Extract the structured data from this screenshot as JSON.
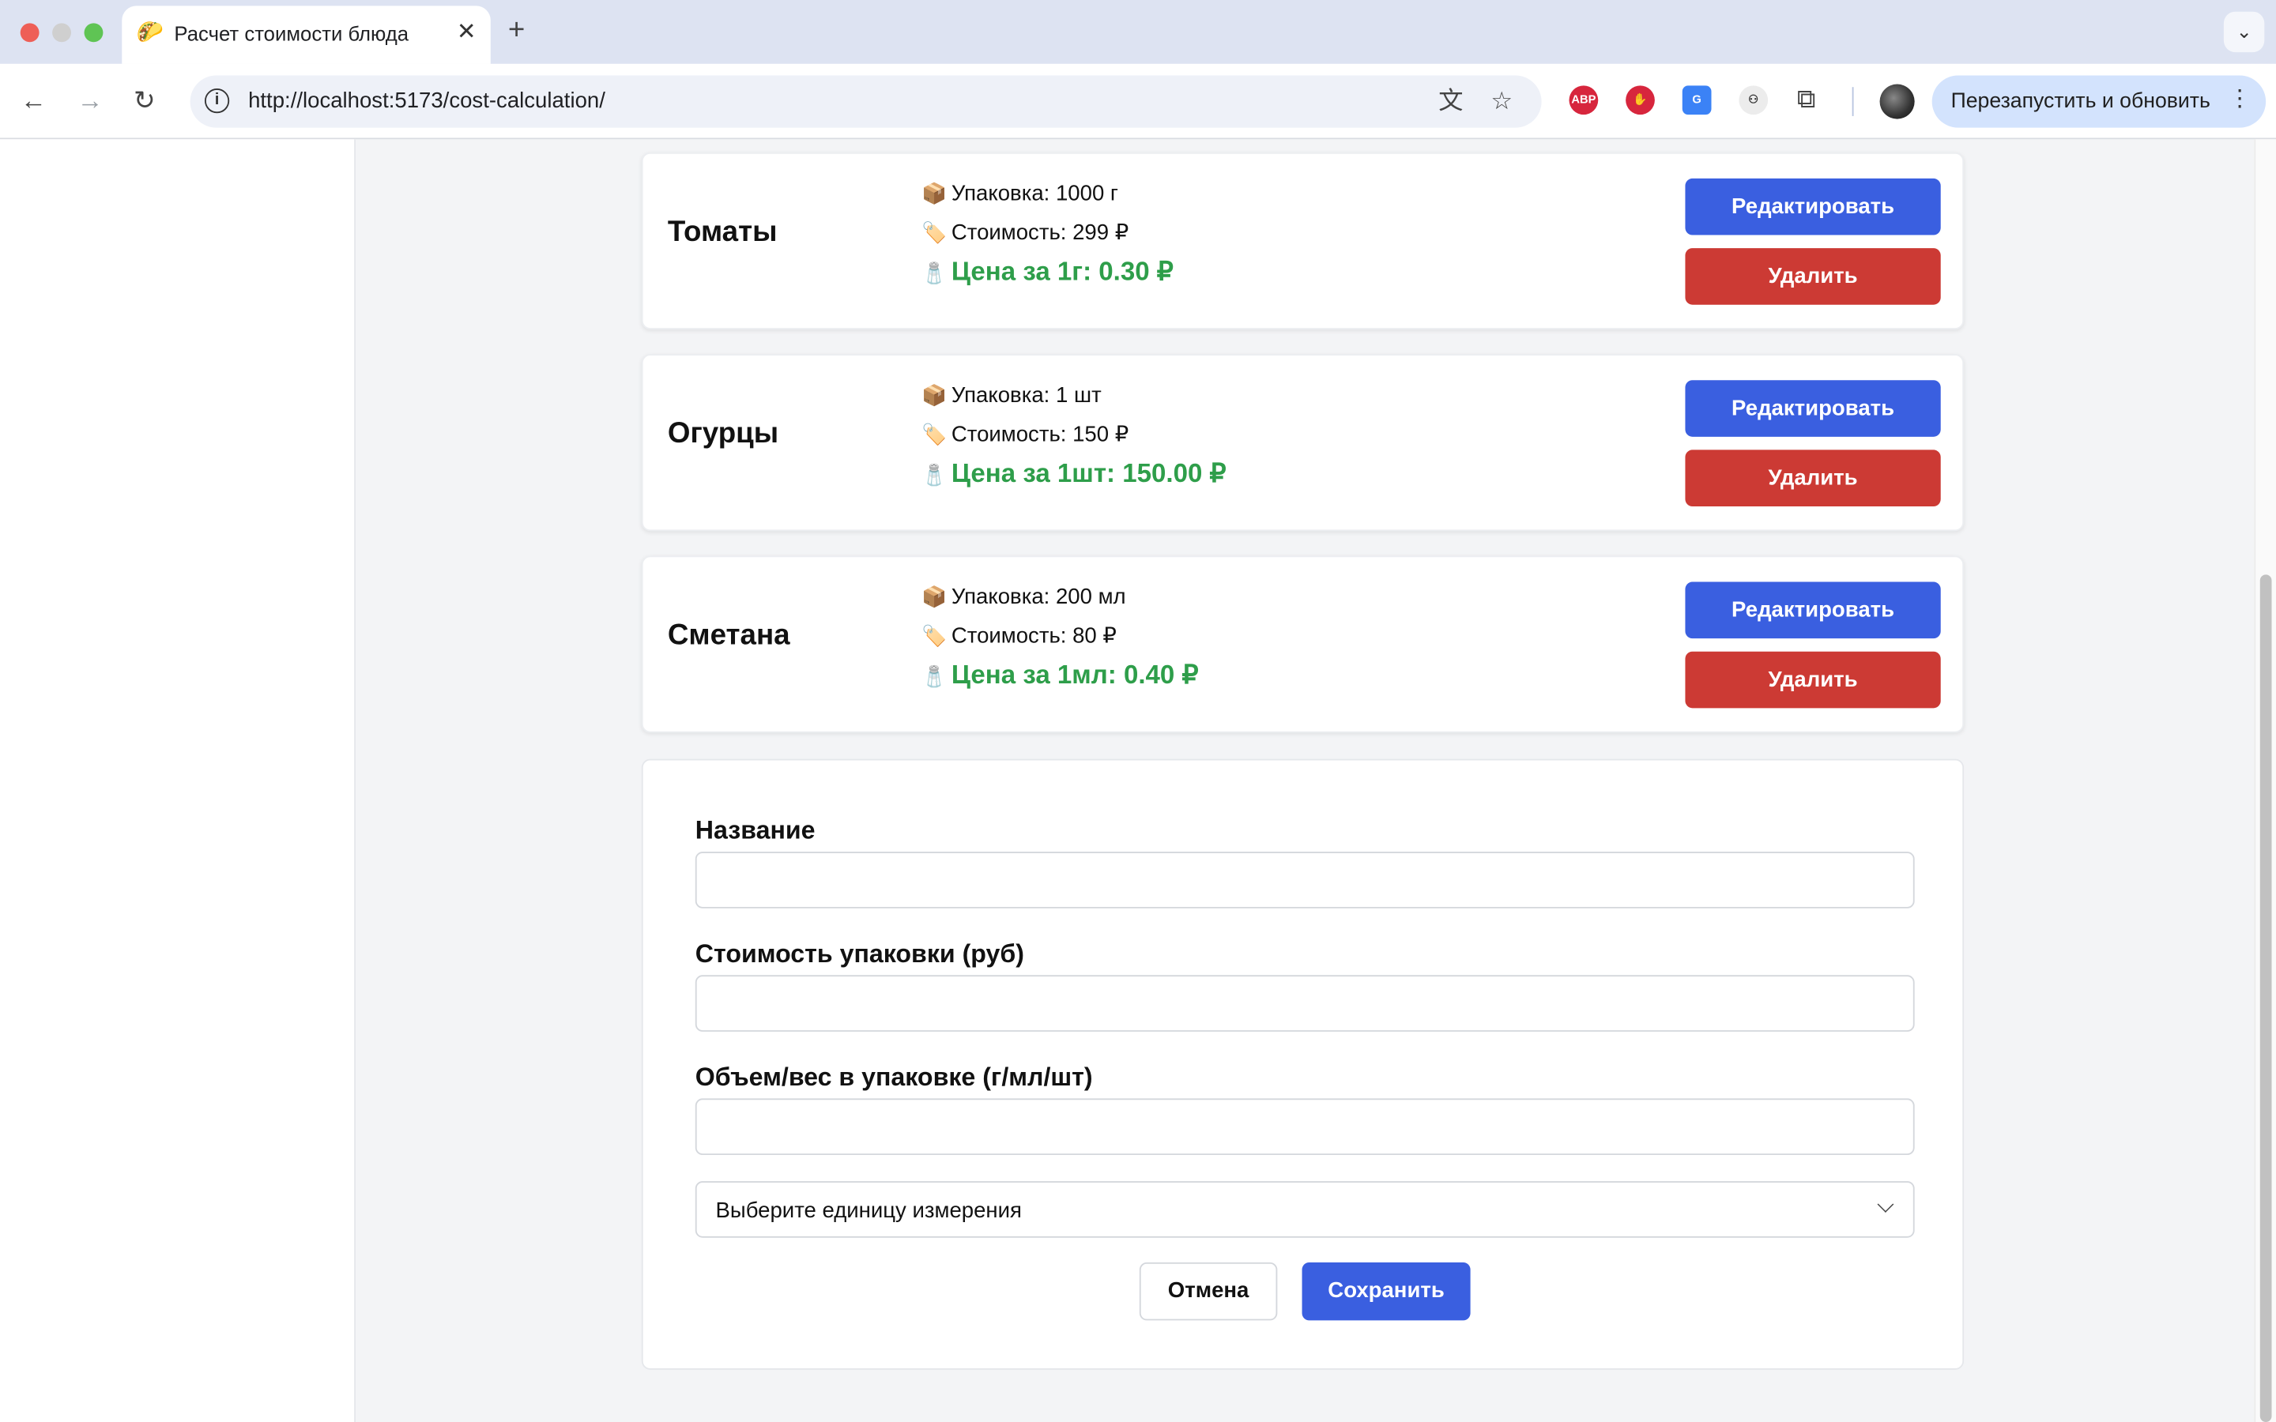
{
  "browser": {
    "tab_favicon": "🌮",
    "tab_title": "Расчет стоимости блюда",
    "tab_close": "✕",
    "new_tab": "+",
    "tab_menu": "⌄",
    "url": "http://localhost:5173/cost-calculation/",
    "relaunch_label": "Перезапустить и обновить",
    "ext_abp": "ABP"
  },
  "products": [
    {
      "name": "Томаты",
      "package": "Упаковка: 1000 г",
      "cost": "Стоимость: 299 ₽",
      "unit_price": "Цена за 1г: 0.30 ₽",
      "edit_label": "Редактировать",
      "delete_label": "Удалить"
    },
    {
      "name": "Огурцы",
      "package": "Упаковка: 1 шт",
      "cost": "Стоимость: 150 ₽",
      "unit_price": "Цена за 1шт: 150.00 ₽",
      "edit_label": "Редактировать",
      "delete_label": "Удалить"
    },
    {
      "name": "Сметана",
      "package": "Упаковка: 200 мл",
      "cost": "Стоимость: 80 ₽",
      "unit_price": "Цена за 1мл: 0.40 ₽",
      "edit_label": "Редактировать",
      "delete_label": "Удалить"
    }
  ],
  "icons": {
    "package": "📦",
    "cost": "🏷️",
    "unit_price": "🧂"
  },
  "form": {
    "name_label": "Название",
    "name_value": "",
    "cost_label": "Стоимость упаковки (руб)",
    "cost_value": "",
    "volume_label": "Объем/вес в упаковке (г/мл/шт)",
    "volume_value": "",
    "unit_select_value": "Выберите единицу измерения",
    "cancel_label": "Отмена",
    "save_label": "Сохранить"
  },
  "colors": {
    "primary": "#3a5fe0",
    "danger": "#cc3a34",
    "price_green": "#2e9e4a"
  }
}
